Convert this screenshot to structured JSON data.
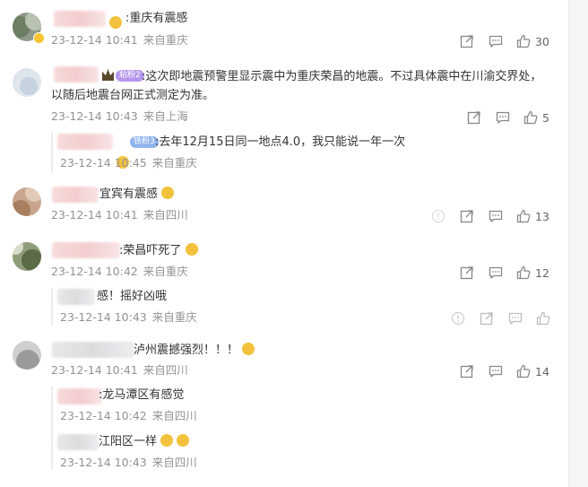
{
  "comments": [
    {
      "text": ":重庆有震感",
      "time": "23-12-14 10:41",
      "location": "来自重庆",
      "likes": "30",
      "replies": []
    },
    {
      "text": ":这次即地震预警里显示震中为重庆荣昌的地震。不过具体震中在川渝交界处，",
      "text2": "以随后地震台网正式测定为准。",
      "time": "23-12-14 10:43",
      "location": "来自上海",
      "likes": "5",
      "badge": "粘粉2",
      "replies": [
        {
          "text": ":去年12月15日同一地点4.0，我只能说一年一次",
          "time": "23-12-14 10:45",
          "location": "来自重庆",
          "badge": "铁粉3"
        }
      ]
    },
    {
      "text": "宜宾有震感",
      "time": "23-12-14 10:41",
      "location": "来自四川",
      "likes": "13",
      "replies": []
    },
    {
      "text": ":荣昌吓死了",
      "time": "23-12-14 10:42",
      "location": "来自重庆",
      "likes": "12",
      "replies": [
        {
          "text": "感！摇好凶哦",
          "time": "23-12-14 10:43",
          "location": "来自重庆"
        }
      ]
    },
    {
      "text": "泸州震撼强烈！！！",
      "time": "23-12-14 10:41",
      "location": "来自四川",
      "likes": "14",
      "replies": [
        {
          "text": ":龙马潭区有感觉",
          "time": "23-12-14 10:42",
          "location": "来自四川"
        },
        {
          "text": "江阳区一样",
          "time": "23-12-14 10:43",
          "location": "来自四川"
        }
      ]
    }
  ],
  "icons": {
    "share": "share-icon",
    "comment": "comment-icon",
    "like": "like-icon",
    "report": "report-icon"
  }
}
